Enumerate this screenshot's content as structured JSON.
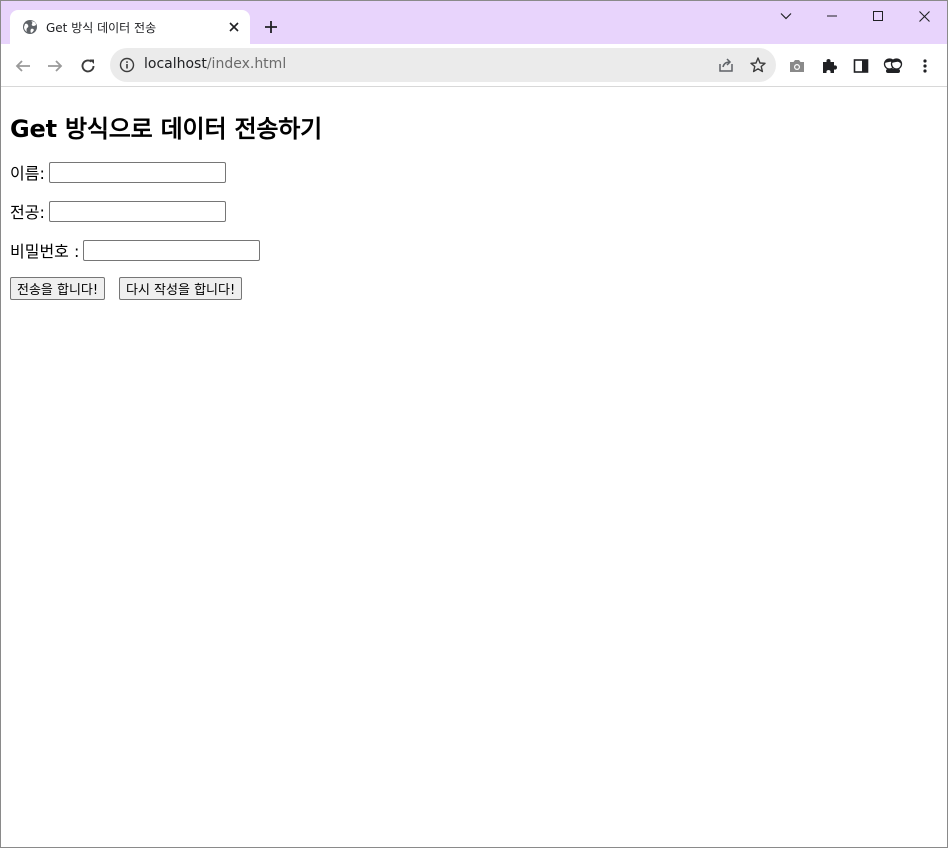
{
  "browser": {
    "tab_title": "Get 방식 데이터 전송",
    "url_host": "localhost",
    "url_path": "/index.html",
    "accent_color": "#e8d4fc",
    "icons": [
      "globe-icon",
      "close-icon",
      "plus-icon",
      "back-icon",
      "forward-icon",
      "reload-icon",
      "info-icon",
      "share-icon",
      "star-icon",
      "camera-icon",
      "extension-icon",
      "side-panel-icon",
      "profile-icon",
      "menu-icon",
      "chevron-down-icon",
      "minimize-icon",
      "maximize-icon",
      "window-close-icon"
    ]
  },
  "page": {
    "heading": "Get 방식으로 데이터 전송하기",
    "form": {
      "name_label": "이름:",
      "name_value": "",
      "major_label": "전공:",
      "major_value": "",
      "password_label": "비밀번호 :",
      "password_value": "",
      "submit_label": "전송을 합니다!",
      "reset_label": "다시 작성을 합니다!"
    }
  }
}
